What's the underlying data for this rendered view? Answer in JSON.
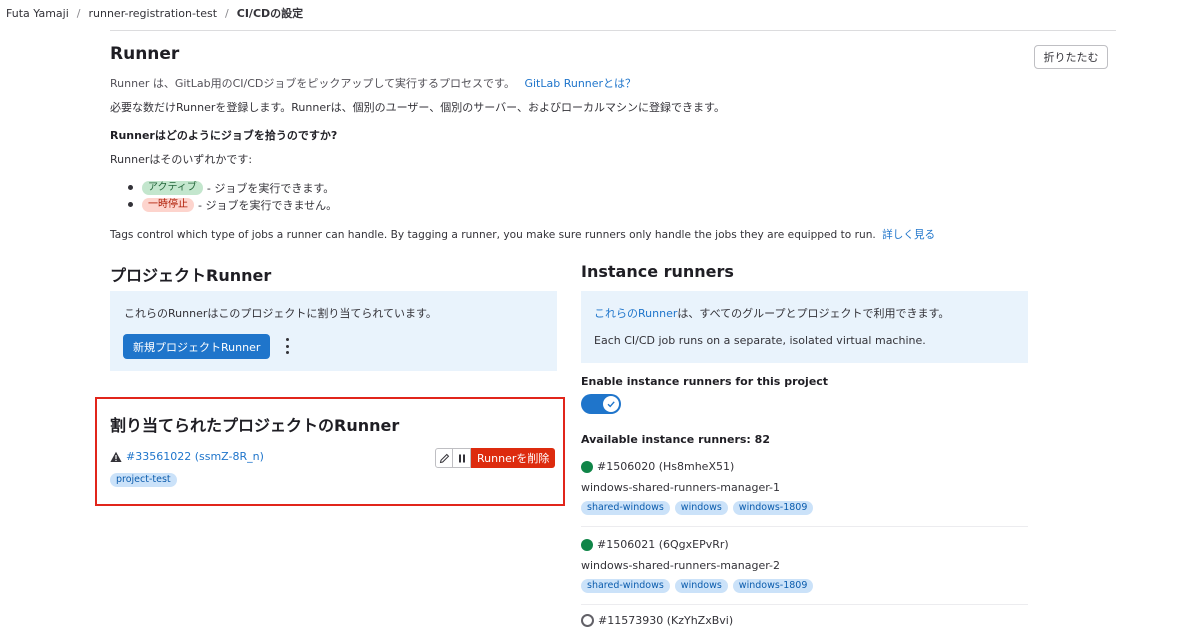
{
  "breadcrumb": [
    "Futa Yamaji",
    "runner-registration-test",
    "CI/CDの設定"
  ],
  "runner_section": {
    "title": "Runner",
    "collapse_label": "折りたたむ",
    "intro": "Runner は、GitLab用のCI/CDジョブをピックアップして実行するプロセスです。",
    "intro_link": "GitLab Runnerとは？",
    "register": "必要な数だけRunnerを登録します。Runnerは、個別のユーザー、個別のサーバー、およびローカルマシンに登録できます。",
    "question": "Runnerはどのようにジョブを拾うのですか?",
    "either": "Runnerはそのいずれかです:",
    "states": [
      {
        "badge": "アクティブ",
        "text": "- ジョブを実行できます。"
      },
      {
        "badge": "一時停止",
        "text": "- ジョブを実行できません。"
      }
    ],
    "tags_text": "Tags control which type of jobs a runner can handle. By tagging a runner, you make sure runners only handle the jobs they are equipped to run.",
    "tags_link": "詳しく見る"
  },
  "project_runners": {
    "title": "プロジェクトRunner",
    "info": "これらのRunnerはこのプロジェクトに割り当てられています。",
    "new_button": "新規プロジェクトRunner",
    "assigned_title": "割り当てられたプロジェクトのRunner",
    "runner_id": "#33561022 (ssmZ-8R_n)",
    "runner_tag": "project-test",
    "remove_button": "Runnerを削除"
  },
  "instance_runners": {
    "title": "Instance runners",
    "info_link": "これらのRunner",
    "info_text": "は、すべてのグループとプロジェクトで利用できます。",
    "info_text2": "Each CI/CD job runs on a separate, isolated virtual machine.",
    "toggle_label": "Enable instance runners for this project",
    "available": "Available instance runners: 82",
    "runners": [
      {
        "id": "#1506020 (Hs8mheX51)",
        "name": "windows-shared-runners-manager-1",
        "tags": [
          "shared-windows",
          "windows",
          "windows-1809"
        ]
      },
      {
        "id": "#1506021 (6QgxEPvRr)",
        "name": "windows-shared-runners-manager-2",
        "tags": [
          "shared-windows",
          "windows",
          "windows-1809"
        ]
      },
      {
        "id": "#11573930 (KzYhZxBvi)"
      }
    ]
  },
  "colors": {
    "link": "#1f75cb",
    "danger": "#dd2b0e",
    "online": "#108548",
    "info_bg": "#e9f3fc",
    "frame": "#e1251b"
  }
}
